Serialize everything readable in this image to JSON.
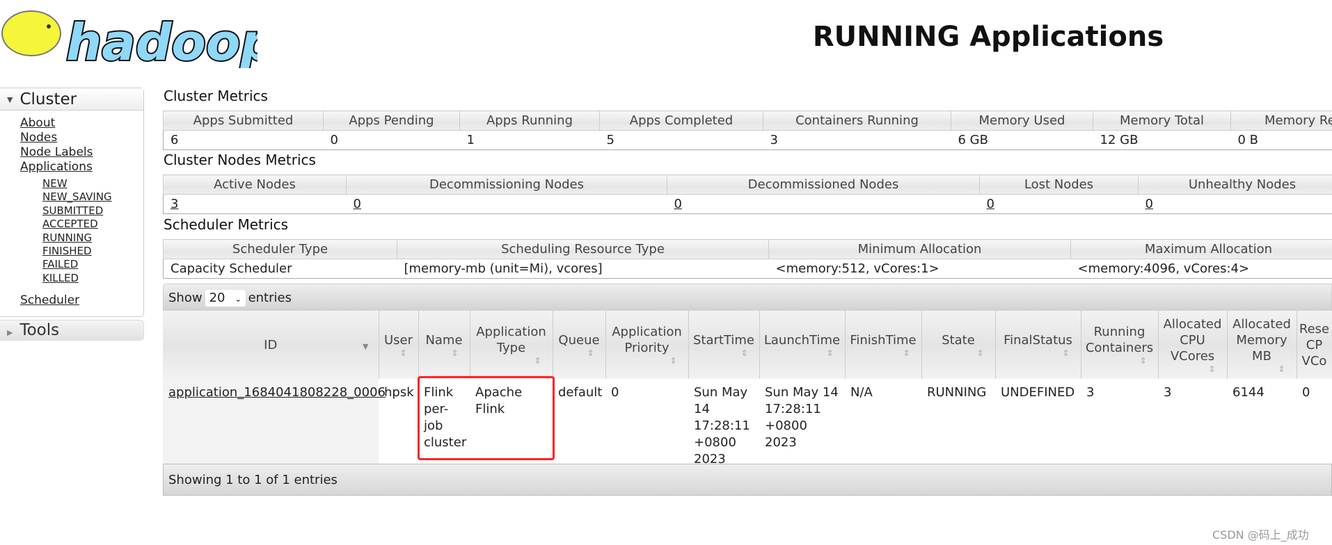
{
  "logo_text": "hadoop",
  "title": "RUNNING Applications",
  "sidebar": {
    "cluster_label": "Cluster",
    "links": [
      "About",
      "Nodes",
      "Node Labels",
      "Applications"
    ],
    "states": [
      "NEW",
      "NEW_SAVING",
      "SUBMITTED",
      "ACCEPTED",
      "RUNNING",
      "FINISHED",
      "FAILED",
      "KILLED"
    ],
    "scheduler": "Scheduler",
    "tools_label": "Tools"
  },
  "cluster_metrics": {
    "title": "Cluster Metrics",
    "headers": [
      "Apps Submitted",
      "Apps Pending",
      "Apps Running",
      "Apps Completed",
      "Containers Running",
      "Memory Used",
      "Memory Total",
      "Memory Re"
    ],
    "values": [
      "6",
      "0",
      "1",
      "5",
      "3",
      "6 GB",
      "12 GB",
      "0 B"
    ]
  },
  "node_metrics": {
    "title": "Cluster Nodes Metrics",
    "headers": [
      "Active Nodes",
      "Decommissioning Nodes",
      "Decommissioned Nodes",
      "Lost Nodes",
      "Unhealthy Nodes"
    ],
    "values": [
      "3",
      "0",
      "0",
      "0",
      "0"
    ]
  },
  "scheduler_metrics": {
    "title": "Scheduler Metrics",
    "headers": [
      "Scheduler Type",
      "Scheduling Resource Type",
      "Minimum Allocation",
      "Maximum Allocation"
    ],
    "values": [
      "Capacity Scheduler",
      "[memory-mb (unit=Mi), vcores]",
      "<memory:512, vCores:1>",
      "<memory:4096, vCores:4>"
    ]
  },
  "apps": {
    "show_label": "Show",
    "page_size": "20",
    "entries_label": "entries",
    "headers": [
      "ID",
      "User",
      "Name",
      "Application Type",
      "Queue",
      "Application Priority",
      "StartTime",
      "LaunchTime",
      "FinishTime",
      "State",
      "FinalStatus",
      "Running Containers",
      "Allocated CPU VCores",
      "Allocated Memory MB",
      "Rese CP VCo"
    ],
    "rows": [
      [
        "application_1684041808228_0006",
        "hpsk",
        "Flink per-job cluster",
        "Apache Flink",
        "default",
        "0",
        "Sun May 14 17:28:11 +0800 2023",
        "Sun May 14 17:28:11 +0800 2023",
        "N/A",
        "RUNNING",
        "UNDEFINED",
        "3",
        "3",
        "6144",
        "0"
      ]
    ],
    "footer": "Showing 1 to 1 of 1 entries"
  },
  "watermark": "CSDN @码上_成功"
}
